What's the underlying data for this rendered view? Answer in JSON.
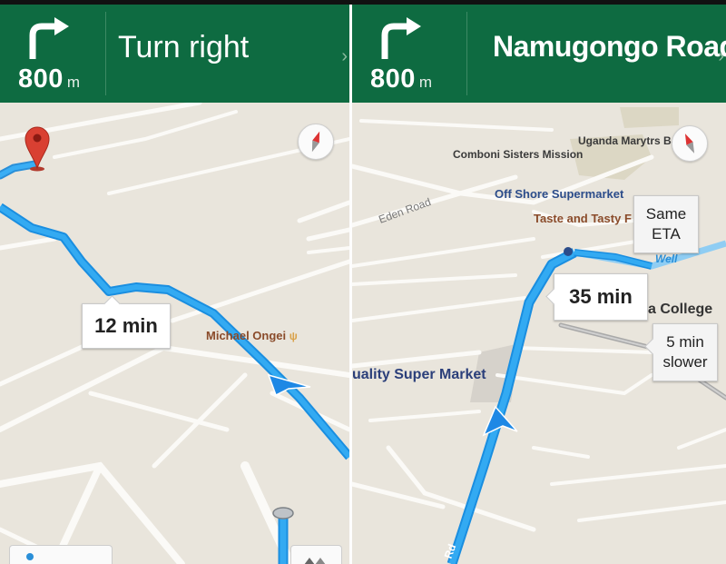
{
  "left": {
    "header": {
      "turn_icon": "turn-right-arrow-icon",
      "distance": "800",
      "unit": "m",
      "instruction": "Turn right",
      "more_icon": "chevron-right-icon"
    },
    "callout_time": "12 min",
    "poi": {
      "name": "Michael Ongei",
      "icon": "restaurant-icon"
    },
    "icons": {
      "compass": "compass-icon",
      "pin": "location-pin-icon",
      "arrow": "navigation-arrow-icon"
    }
  },
  "right": {
    "header": {
      "turn_icon": "turn-right-arrow-icon",
      "distance": "800",
      "unit": "m",
      "instruction": "Namugongo Road",
      "more_icon": "chevron-right-icon"
    },
    "callout_time": "35 min",
    "alt_routes": [
      {
        "line1": "Same",
        "line2": "ETA"
      },
      {
        "line1": "5 min",
        "line2": "slower"
      }
    ],
    "places": {
      "comboni": "Comboni Sisters Mission",
      "uganda": "Uganda Marytrs Bassilic",
      "offshore": "Off Shore Supermarket",
      "taste": "Taste and Tasty F",
      "eden": "Eden Road",
      "college": "a College",
      "quality": "uality Super Market",
      "well": "Well",
      "rd": "Rd"
    },
    "icons": {
      "compass": "compass-icon",
      "arrow": "navigation-arrow-icon"
    }
  },
  "colors": {
    "header_green": "#0e6b41",
    "route_blue": "#1ea3f0",
    "map_bg": "#e9e5dc"
  }
}
